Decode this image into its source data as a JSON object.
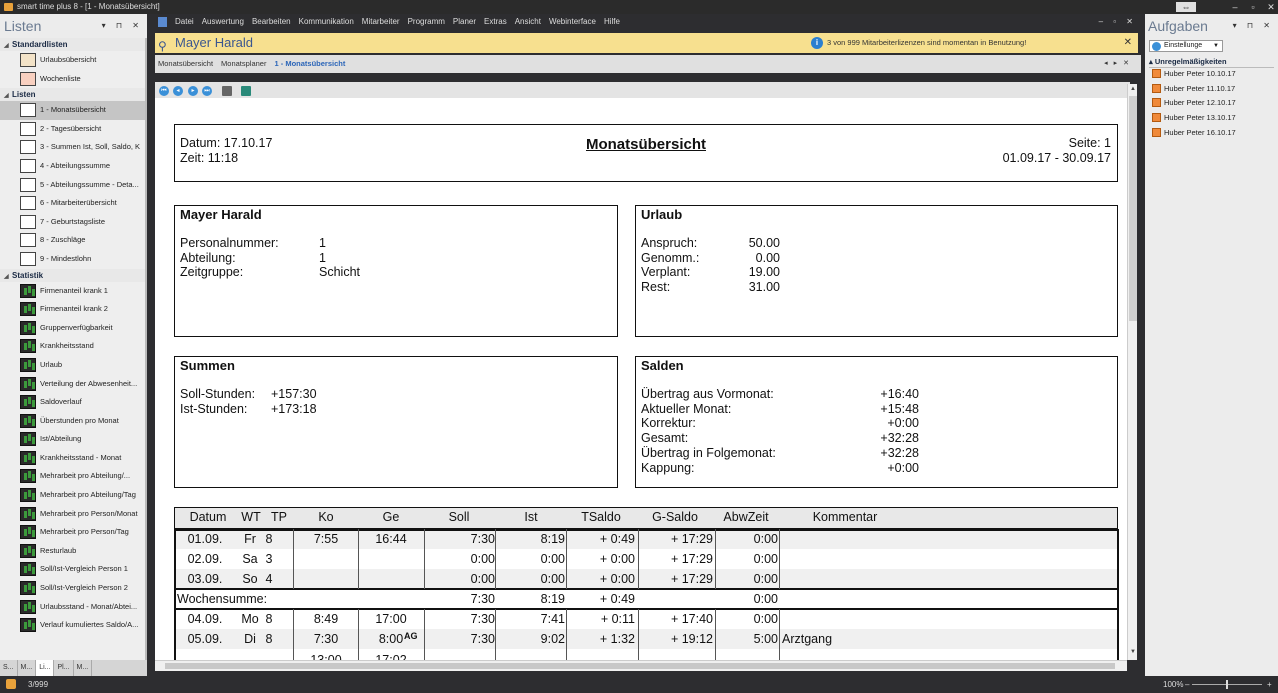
{
  "window": {
    "title": "smart time plus 8 - [1 - Monatsübersicht]"
  },
  "left_panel": {
    "title": "Listen",
    "groups": [
      {
        "label": "Standardlisten",
        "items": [
          "Urlaubsübersicht",
          "Wochenliste"
        ]
      },
      {
        "label": "Listen",
        "items": [
          "1 - Monatsübersicht",
          "2 - Tagesübersicht",
          "3 - Summen Ist, Soll, Saldo, K",
          "4 - Abteilungssumme",
          "5 - Abteilungssumme  - Deta...",
          "6 - Mitarbeiterübersicht",
          "7 - Geburtstagsliste",
          "8 - Zuschläge",
          "9 - Mindestlohn"
        ]
      },
      {
        "label": "Statistik",
        "items": [
          "Firmenanteil krank 1",
          "Firmenanteil krank 2",
          "Gruppenverfügbarkeit",
          "Krankheitsstand",
          "Urlaub",
          "Verteilung der Abwesenheit...",
          "Saldoverlauf",
          "Überstunden pro Monat",
          "Ist/Abteilung",
          "Krankheitsstand - Monat",
          "Mehrarbeit pro Abteilung/...",
          "Mehrarbeit pro Abteilung/Tag",
          "Mehrarbeit pro Person/Monat",
          "Mehrarbeit pro Person/Tag",
          "Resturlaub",
          "Soll/Ist-Vergleich Person 1",
          "Soll/Ist-Vergleich Person 2",
          "Urlaubsstand - Monat/Abtei...",
          "Verlauf kumuliertes Saldo/A..."
        ]
      }
    ],
    "selected_item": "1 - Monatsübersicht",
    "bottom_tabs": [
      "S...",
      "M...",
      "Li...",
      "Pl...",
      "M..."
    ]
  },
  "menu": [
    "Datei",
    "Auswertung",
    "Bearbeiten",
    "Kommunikation",
    "Mitarbeiter",
    "Programm",
    "Planer",
    "Extras",
    "Ansicht",
    "Webinterface",
    "Hilfe"
  ],
  "employee_bar": {
    "name": "Mayer Harald"
  },
  "info_bar": {
    "text": "3 von 999 Mitarbeiterlizenzen sind momentan in Benutzung!"
  },
  "tabs": [
    "Monatsübersicht",
    "Monatsplaner",
    "1 - Monatsübersicht"
  ],
  "report": {
    "header": {
      "datum": "Datum: 17.10.17",
      "zeit": "Zeit: 11:18",
      "title": "Monatsübersicht",
      "seite": "Seite: 1",
      "range": "01.09.17 - 30.09.17"
    },
    "employee": {
      "name": "Mayer Harald",
      "rows": [
        [
          "Personalnummer:",
          "1"
        ],
        [
          "Abteilung:",
          "1"
        ],
        [
          "Zeitgruppe:",
          "Schicht"
        ]
      ]
    },
    "urlaub": {
      "title": "Urlaub",
      "rows": [
        [
          "Anspruch:",
          "50.00"
        ],
        [
          "Genomm.:",
          "0.00"
        ],
        [
          "Verplant:",
          "19.00"
        ],
        [
          "Rest:",
          "31.00"
        ]
      ]
    },
    "summen": {
      "title": "Summen",
      "rows": [
        [
          "Soll-Stunden:",
          "+157:30"
        ],
        [
          "Ist-Stunden:",
          "+173:18"
        ]
      ]
    },
    "salden": {
      "title": "Salden",
      "rows": [
        [
          "Übertrag aus Vormonat:",
          "+16:40"
        ],
        [
          "Aktueller Monat:",
          "+15:48"
        ],
        [
          "Korrektur:",
          "+0:00"
        ],
        [
          "Gesamt:",
          "+32:28"
        ],
        [
          "Übertrag in Folgemonat:",
          "+32:28"
        ],
        [
          "Kappung:",
          "+0:00"
        ]
      ]
    },
    "table": {
      "columns": [
        "Datum",
        "WT",
        "TP",
        "Ko",
        "Ge",
        "Soll",
        "Ist",
        "TSaldo",
        "G-Saldo",
        "AbwZeit",
        "Kommentar"
      ],
      "rows": [
        {
          "datum": "01.09.",
          "wt": "Fr",
          "tp": "8",
          "ko": "7:55",
          "ge": "16:44",
          "ge_flag": "",
          "soll": "7:30",
          "ist": "8:19",
          "tsaldo": "+ 0:49",
          "gsaldo": "+ 17:29",
          "abw": "0:00",
          "kommentar": ""
        },
        {
          "datum": "02.09.",
          "wt": "Sa",
          "tp": "3",
          "ko": "",
          "ge": "",
          "ge_flag": "",
          "soll": "0:00",
          "ist": "0:00",
          "tsaldo": "+ 0:00",
          "gsaldo": "+ 17:29",
          "abw": "0:00",
          "kommentar": ""
        },
        {
          "datum": "03.09.",
          "wt": "So",
          "tp": "4",
          "ko": "",
          "ge": "",
          "ge_flag": "",
          "soll": "0:00",
          "ist": "0:00",
          "tsaldo": "+ 0:00",
          "gsaldo": "+ 17:29",
          "abw": "0:00",
          "kommentar": ""
        },
        {
          "datum": "04.09.",
          "wt": "Mo",
          "tp": "8",
          "ko": "8:49",
          "ge": "17:00",
          "ge_flag": "",
          "soll": "7:30",
          "ist": "7:41",
          "tsaldo": "+ 0:11",
          "gsaldo": "+ 17:40",
          "abw": "0:00",
          "kommentar": ""
        },
        {
          "datum": "05.09.",
          "wt": "Di",
          "tp": "8",
          "ko": "7:30",
          "ge": "8:00",
          "ge_flag": "AG",
          "soll": "7:30",
          "ist": "9:02",
          "tsaldo": "+ 1:32",
          "gsaldo": "+ 19:12",
          "abw": "5:00",
          "kommentar": "Arztgang"
        }
      ],
      "week_sum": {
        "label": "Wochensumme:",
        "soll": "7:30",
        "ist": "8:19",
        "tsaldo": "+ 0:49",
        "abw": "0:00"
      },
      "partial_row": {
        "ko": "13:00",
        "ge": "17:02"
      }
    }
  },
  "right_panel": {
    "title": "Aufgaben",
    "dropdown": "Einstellunge",
    "group": "Unregelmäßigkeiten",
    "tasks": [
      "Huber Peter 10.10.17",
      "Huber Peter 11.10.17",
      "Huber Peter 12.10.17",
      "Huber Peter 13.10.17",
      "Huber Peter 16.10.17"
    ]
  },
  "status": {
    "count": "3/999",
    "zoom": "100%"
  },
  "colors": {
    "employee_bar": "#f7e08f",
    "accent": "#2b65b8",
    "task_marker": "#f08a3a"
  }
}
